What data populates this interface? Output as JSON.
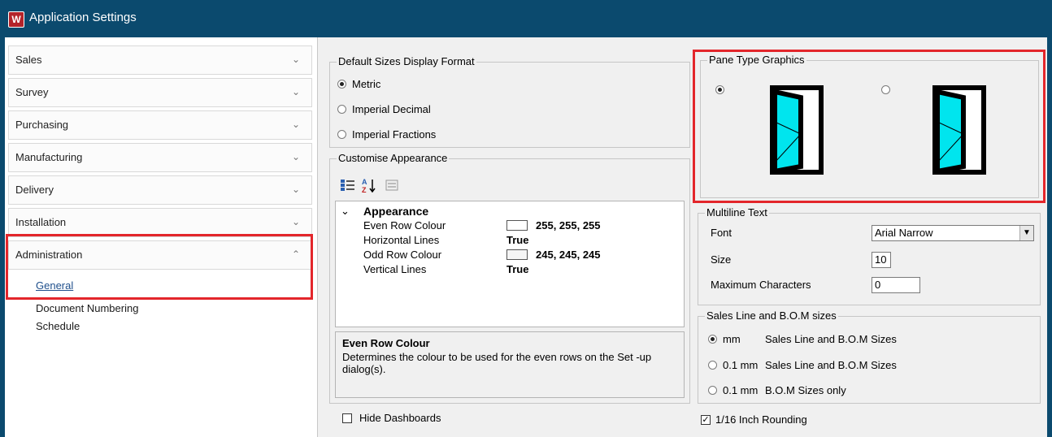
{
  "window": {
    "title": "Application Settings",
    "logo_letter": "W"
  },
  "sidebar": {
    "sections": [
      {
        "label": "Sales",
        "chevron": "⌄"
      },
      {
        "label": "Survey",
        "chevron": "⌄"
      },
      {
        "label": "Purchasing",
        "chevron": "⌄"
      },
      {
        "label": "Manufacturing",
        "chevron": "⌄"
      },
      {
        "label": "Delivery",
        "chevron": "⌄"
      },
      {
        "label": "Installation",
        "chevron": "⌄"
      },
      {
        "label": "Administration",
        "chevron": "⌃"
      }
    ],
    "sub_items": [
      "General",
      "Document Numbering",
      "Schedule"
    ]
  },
  "display_format": {
    "caption": "Default Sizes Display Format",
    "options": [
      "Metric",
      "Imperial Decimal",
      "Imperial Fractions"
    ],
    "selected": 0
  },
  "appearance": {
    "caption": "Customise Appearance",
    "category": "Appearance",
    "properties": [
      {
        "name": "Even Row Colour",
        "value": "255, 255, 255",
        "swatch": "#ffffff"
      },
      {
        "name": "Horizontal Lines",
        "value": "True"
      },
      {
        "name": "Odd Row Colour",
        "value": "245, 245, 245",
        "swatch": "#f5f5f5"
      },
      {
        "name": "Vertical Lines",
        "value": "True"
      }
    ],
    "help_title": "Even Row Colour",
    "help_text": "Determines the colour to be used for the even rows on the Set -up dialog(s)."
  },
  "pane_graphics": {
    "caption": "Pane Type Graphics",
    "selected": 0,
    "pane_color": "#00e5ee"
  },
  "multiline": {
    "caption": "Multiline Text",
    "font_label": "Font",
    "font_value": "Arial Narrow",
    "size_label": "Size",
    "size_value": "10",
    "max_label": "Maximum Characters",
    "max_value": "0"
  },
  "bom_sizes": {
    "caption": "Sales Line and B.O.M sizes",
    "options": [
      {
        "unit": "mm",
        "text": "Sales Line and B.O.M Sizes"
      },
      {
        "unit": "0.1 mm",
        "text": "Sales Line and B.O.M Sizes"
      },
      {
        "unit": "0.1 mm",
        "text": "B.O.M Sizes only"
      }
    ],
    "selected": 0
  },
  "hide_dashboards": {
    "label": "Hide Dashboards",
    "checked": false
  },
  "inch_rounding": {
    "label": "1/16 Inch Rounding",
    "checked": true,
    "mark": "✓"
  }
}
